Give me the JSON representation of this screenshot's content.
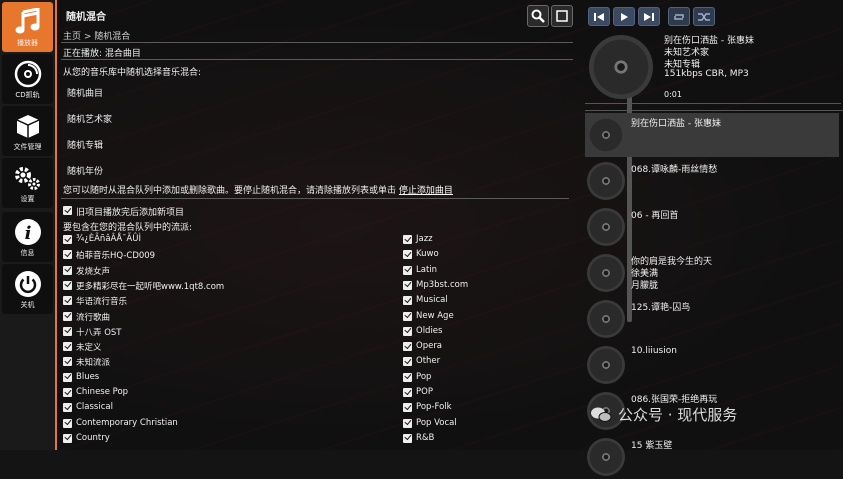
{
  "sidebar": {
    "items": [
      {
        "label": "播放器",
        "icon": "music-note-icon"
      },
      {
        "label": "CD抓轨",
        "icon": "cd-rip-icon"
      },
      {
        "label": "文件管理",
        "icon": "box-icon"
      },
      {
        "label": "设置",
        "icon": "gears-icon"
      },
      {
        "label": "信息",
        "icon": "info-icon"
      },
      {
        "label": "关机",
        "icon": "power-icon"
      }
    ]
  },
  "main": {
    "title": "随机混合",
    "breadcrumb": "主页 > 随机混合",
    "now_playing": "正在播放:  混合曲目",
    "intro": "从您的音乐库中随机选择音乐混合:",
    "options": [
      "随机曲目",
      "随机艺术家",
      "随机专辑",
      "随机年份"
    ],
    "hint": "您可以随时从混合队列中添加或删除歌曲。要停止随机混合，请清除播放列表或单击",
    "hint_link": "停止添加曲目",
    "add_after_label": "旧项目播放完后添加新项目",
    "genres_heading": "要包含在您的混合队列中的流派:",
    "genres_left": [
      "¾¿ÈÃñâÂÅ¯ÃÛÌ",
      "柏菲音乐HQ-CD009",
      "发烧女声",
      "更多精彩尽在一起听吧www.1qt8.com",
      "华语流行音乐",
      "流行歌曲",
      "十八弄 OST",
      "未定义",
      "未知流派",
      "Blues",
      "Chinese Pop",
      "Classical",
      "Contemporary Christian",
      "Country"
    ],
    "genres_right": [
      "Jazz",
      "Kuwo",
      "Latin",
      "Mp3bst.com",
      "Musical",
      "New Age",
      "Oldies",
      "Opera",
      "Other",
      "Pop",
      "POP",
      "Pop-Folk",
      "Pop Vocal",
      "R&B"
    ]
  },
  "player": {
    "track_title": "别在伤口洒盐 - 张惠妹",
    "artist": "未知艺术家",
    "album": "未知专辑",
    "format": "151kbps CBR, MP3",
    "time": "0:01"
  },
  "queue": [
    {
      "title": "别在伤口洒盐 - 张惠妹",
      "sub1": "",
      "sub2": ""
    },
    {
      "title": "068.谭咏麟-雨丝情愁",
      "sub1": "",
      "sub2": ""
    },
    {
      "title": "06 - 再回首",
      "sub1": "",
      "sub2": ""
    },
    {
      "title": "你的肩是我今生的天",
      "sub1": "徐美满",
      "sub2": "月朦胧"
    },
    {
      "title": "125.谭艳-囚鸟",
      "sub1": "",
      "sub2": ""
    },
    {
      "title": "10.liiusion",
      "sub1": "",
      "sub2": ""
    },
    {
      "title": "086.张国荣-拒绝再玩",
      "sub1": "",
      "sub2": ""
    },
    {
      "title": "15 紫玉壁",
      "sub1": "",
      "sub2": ""
    }
  ],
  "watermark": "公众号 · 现代服务",
  "colors": {
    "accent": "#e8772e",
    "control": "#3a4a63"
  }
}
